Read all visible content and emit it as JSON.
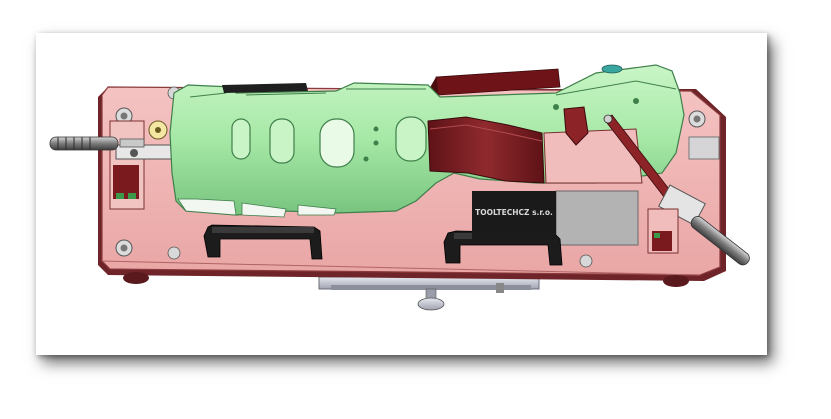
{
  "figure": {
    "logo_text": "TOOLTECHCZ s.r.o."
  },
  "colors": {
    "baseplate": "#efb1b0",
    "baseplate_edge": "#7a3030",
    "part_green": "#a6e8a6",
    "part_green_dark": "#5fae6a",
    "maroon": "#7a1a1e",
    "black": "#1a1a1a",
    "steel": "#b8bcc8",
    "plate_grey": "#b0b0b0"
  },
  "icons": [
    "screw-icon",
    "toggle-clamp",
    "clamp-handle"
  ]
}
